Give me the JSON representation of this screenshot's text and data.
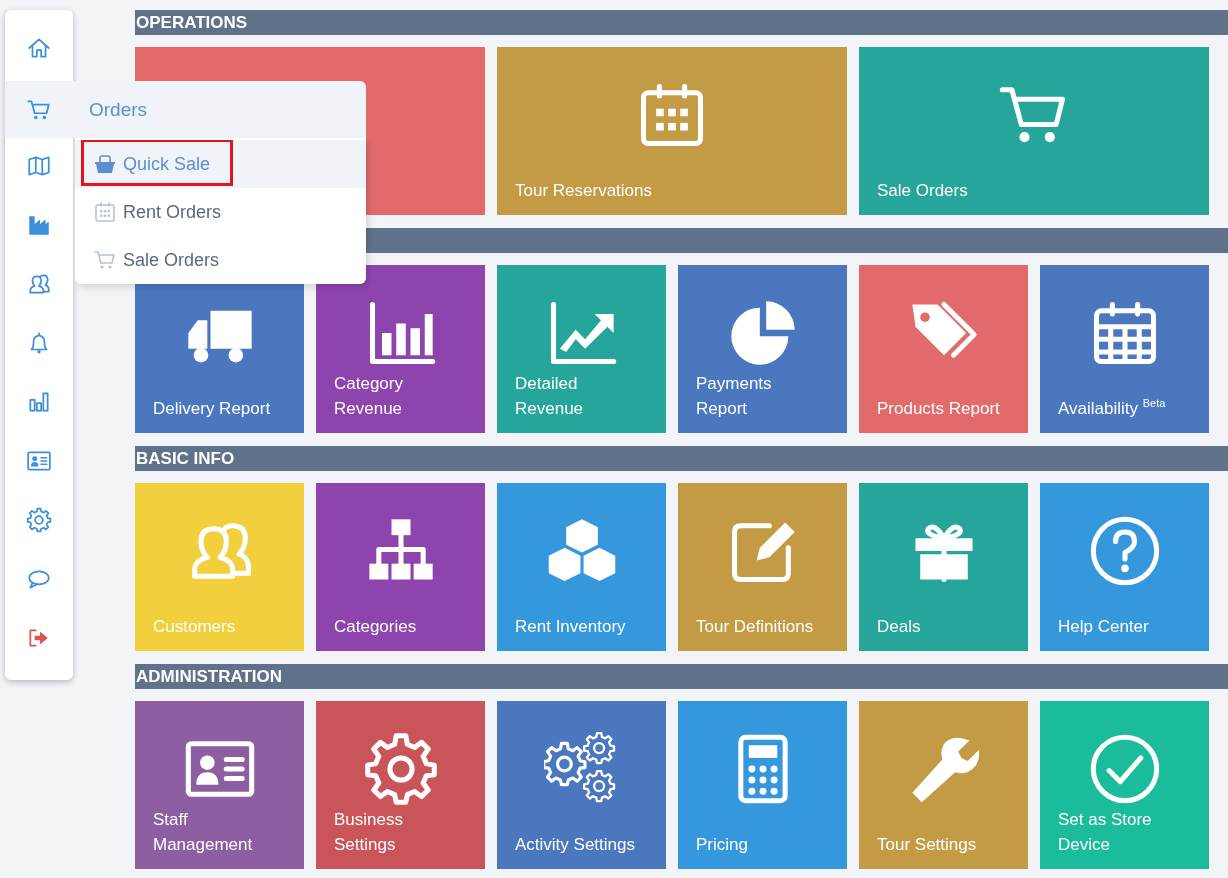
{
  "sidebar": {
    "items": [
      {
        "kind": "home",
        "expanded": false
      },
      {
        "kind": "cart",
        "expanded": true,
        "label": "Orders",
        "children": [
          {
            "kind": "basket",
            "label": "Quick Sale",
            "selected": true,
            "annotated": true
          },
          {
            "kind": "calendar",
            "label": "Rent Orders",
            "selected": false,
            "annotated": false
          },
          {
            "kind": "cart",
            "label": "Sale Orders",
            "selected": false,
            "annotated": false
          }
        ]
      },
      {
        "kind": "map",
        "expanded": false
      },
      {
        "kind": "industry",
        "expanded": false
      },
      {
        "kind": "users",
        "expanded": false
      },
      {
        "kind": "bell",
        "expanded": false
      },
      {
        "kind": "bars",
        "expanded": false
      },
      {
        "kind": "idcard",
        "expanded": false
      },
      {
        "kind": "gear",
        "expanded": false
      },
      {
        "kind": "chat",
        "expanded": false
      },
      {
        "kind": "signout",
        "expanded": false
      }
    ]
  },
  "sections": [
    {
      "title": "OPERATIONS",
      "tiles": [
        {
          "kind": "none",
          "color": "#e26a6a"
        },
        {
          "kind": "calendar",
          "color": "#c49b45",
          "label": [
            "Tour Reservations"
          ]
        },
        {
          "kind": "cart",
          "color": "#26a69a",
          "label": [
            "Sale Orders"
          ]
        }
      ]
    },
    {
      "tiles": [
        {
          "kind": "truck",
          "color": "#4a77be",
          "label": [
            "Delivery Report"
          ]
        },
        {
          "kind": "barchart",
          "color": "#8e44ad",
          "label": [
            "Category",
            "Revenue"
          ]
        },
        {
          "kind": "linechart",
          "color": "#26a69a",
          "label": [
            "Detailed",
            "Revenue"
          ]
        },
        {
          "kind": "pie",
          "color": "#4a77be",
          "label": [
            "Payments",
            "Report"
          ]
        },
        {
          "kind": "tags",
          "color": "#e26a6a",
          "label": [
            "Products Report"
          ]
        },
        {
          "kind": "calgrid",
          "color": "#4a77be",
          "label": [
            "Availability $^{Beta}$"
          ]
        }
      ]
    },
    {
      "title": "BASIC INFO",
      "tiles": [
        {
          "kind": "users",
          "color": "#f2cf3d",
          "label": [
            "Customers"
          ]
        },
        {
          "kind": "sitemap",
          "color": "#8e44ad",
          "label": [
            "Categories"
          ]
        },
        {
          "kind": "cubes",
          "color": "#3598dc",
          "label": [
            "Rent Inventory"
          ]
        },
        {
          "kind": "edit",
          "color": "#c49b45",
          "label": [
            "Tour Definitions"
          ]
        },
        {
          "kind": "gift",
          "color": "#26a69a",
          "label": [
            "Deals"
          ]
        },
        {
          "kind": "question",
          "color": "#3598dc",
          "label": [
            "Help Center"
          ]
        }
      ]
    },
    {
      "title": "ADMINISTRATION",
      "tiles": [
        {
          "kind": "idcard",
          "color": "#8e5ea2",
          "label": [
            "Staff",
            "Management"
          ]
        },
        {
          "kind": "gear",
          "color": "#c9545a",
          "label": [
            "Business",
            "Settings"
          ]
        },
        {
          "kind": "gears",
          "color": "#4a77be",
          "label": [
            "Activity Settings"
          ]
        },
        {
          "kind": "calculator",
          "color": "#3598dc",
          "label": [
            "Pricing"
          ]
        },
        {
          "kind": "wrench",
          "color": "#c49b45",
          "label": [
            "Tour Settings"
          ]
        },
        {
          "kind": "check",
          "color": "#1bbc9b",
          "label": [
            "Set as Store",
            "Device"
          ]
        }
      ]
    }
  ]
}
